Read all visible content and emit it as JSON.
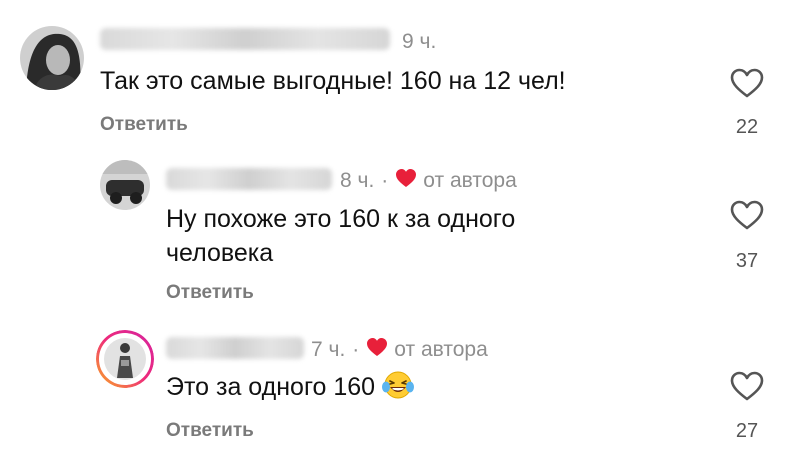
{
  "comments": [
    {
      "time": "9 ч.",
      "text": "Так это самые выгодные! 160 на 12 чел!",
      "reply_label": "Ответить",
      "likes": "22",
      "liked_by_author": false
    },
    {
      "time": "8 ч.",
      "dot": "·",
      "author_badge": "от автора",
      "text_line1": "Ну похоже это 160 к за одного",
      "text_line2": "человека",
      "reply_label": "Ответить",
      "likes": "37",
      "liked_by_author": true
    },
    {
      "time": "7 ч.",
      "dot": "·",
      "author_badge": "от автора",
      "text": "Это за одного 160",
      "emoji": "laughing-tears-emoji",
      "reply_label": "Ответить",
      "likes": "27",
      "liked_by_author": true
    }
  ],
  "colors": {
    "author_heart": "#e8203a",
    "meta_text": "#8e8e8e",
    "reply_text": "#7a7a7a",
    "story_ring_start": "#f9a825",
    "story_ring_end": "#d6249f"
  },
  "icons": {
    "like": "heart-outline-icon",
    "author_like": "heart-filled-icon"
  }
}
